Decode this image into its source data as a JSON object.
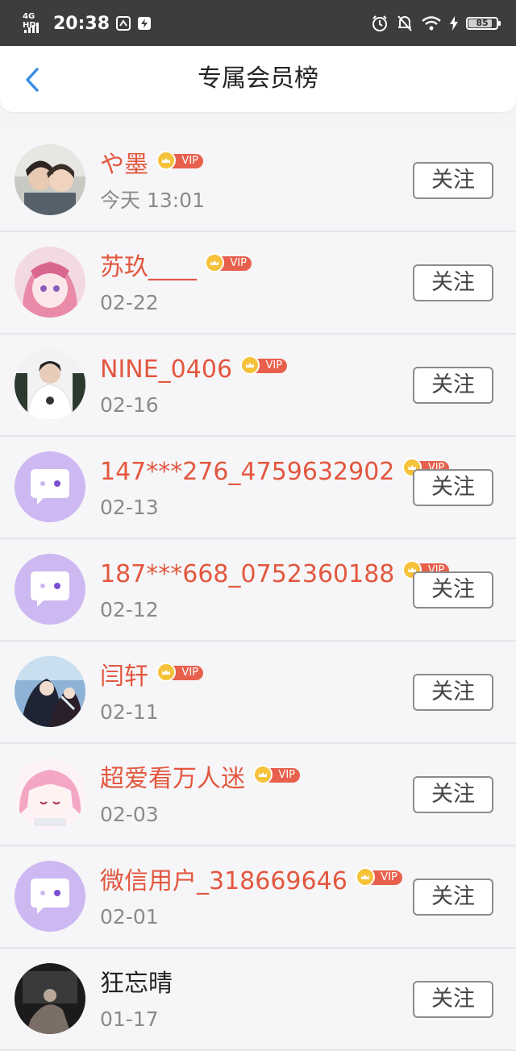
{
  "status_bar": {
    "network": "4G HD",
    "time": "20:38",
    "battery": "85",
    "battery_level": 0.85
  },
  "header": {
    "title": "专属会员榜"
  },
  "members": [
    {
      "name": "や墨",
      "date": "今天 13:01",
      "vip": "VIP",
      "follow": "关注",
      "avatar": "photo-two-girls"
    },
    {
      "name": "苏玖____",
      "date": "02-22",
      "vip": "VIP",
      "follow": "关注",
      "avatar": "anime-pink-hair"
    },
    {
      "name": "NINE_0406",
      "date": "02-16",
      "vip": "VIP",
      "follow": "关注",
      "avatar": "photo-person-white-shirt"
    },
    {
      "name": "147***276_4759632902",
      "date": "02-13",
      "vip": "VIP",
      "follow": "关注",
      "avatar": "default-chat-bubble"
    },
    {
      "name": "187***668_0752360188",
      "date": "02-12",
      "vip": "VIP",
      "follow": "关注",
      "avatar": "default-chat-bubble"
    },
    {
      "name": "闫轩",
      "date": "02-11",
      "vip": "VIP",
      "follow": "关注",
      "avatar": "anime-dark-hair"
    },
    {
      "name": "超爱看万人迷",
      "date": "02-03",
      "vip": "VIP",
      "follow": "关注",
      "avatar": "anime-pink-girl"
    },
    {
      "name": "微信用户_318669646",
      "date": "02-01",
      "vip": "VIP",
      "follow": "关注",
      "avatar": "default-chat-bubble"
    },
    {
      "name": "狂忘晴",
      "date": "01-17",
      "vip": "",
      "follow": "关注",
      "avatar": "photo-dark-scene"
    }
  ],
  "colors": {
    "name_red": "#e3573f",
    "vip_pill": "#e8604c",
    "crown_coin": "#f6c23a",
    "back_arrow": "#3a8ee6",
    "default_avatar": "#cdb8f2"
  }
}
